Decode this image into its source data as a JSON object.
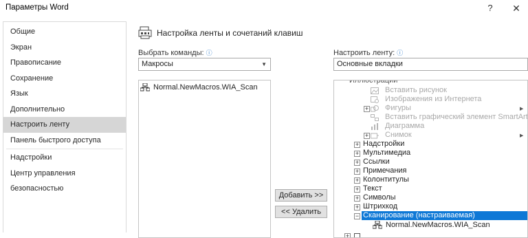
{
  "window": {
    "title": "Параметры Word",
    "help_label": "?",
    "close_label": "✕"
  },
  "nav": {
    "items": [
      {
        "label": "Общие",
        "selected": false
      },
      {
        "label": "Экран",
        "selected": false
      },
      {
        "label": "Правописание",
        "selected": false
      },
      {
        "label": "Сохранение",
        "selected": false
      },
      {
        "label": "Язык",
        "selected": false
      },
      {
        "label": "Дополнительно",
        "selected": false
      },
      {
        "label": "Настроить ленту",
        "selected": true
      },
      {
        "label": "Панель быстрого доступа",
        "selected": false
      },
      {
        "label": "Надстройки",
        "selected": false
      },
      {
        "label": "Центр управления безопасностью",
        "selected": false
      }
    ]
  },
  "main": {
    "header": "Настройка ленты и сочетаний клавиш",
    "choose_commands_label": "Выбрать команды:",
    "choose_commands_value": "Макросы",
    "customize_ribbon_label": "Настроить ленту:",
    "customize_ribbon_value": "Основные вкладки",
    "info_icon": "ⓘ",
    "dropdown_arrow": "▼",
    "left_list": [
      {
        "label": "Normal.NewMacros.WIA_Scan"
      }
    ],
    "add_button": "Добавить >>",
    "remove_button": "<< Удалить",
    "tree": {
      "cut_top": "Иллюстрации",
      "illustrations": [
        {
          "label": "Вставить рисунок",
          "expander": false,
          "arrow": false
        },
        {
          "label": "Изображения из Интернета",
          "expander": false,
          "arrow": false
        },
        {
          "label": "Фигуры",
          "expander": true,
          "arrow": true
        },
        {
          "label": "Вставить графический элемент SmartArt",
          "expander": false,
          "arrow": false
        },
        {
          "label": "Диаграмма",
          "expander": false,
          "arrow": false
        },
        {
          "label": "Снимок",
          "expander": true,
          "arrow": true
        }
      ],
      "groups": [
        "Надстройки",
        "Мультимедиа",
        "Ссылки",
        "Примечания",
        "Колонтитулы",
        "Текст",
        "Символы",
        "Штрихкод"
      ],
      "selected_group": "Сканирование (настраиваемая)",
      "selected_child": "Normal.NewMacros.WIA_Scan",
      "plus_sign": "+",
      "minus_sign": "−",
      "submenu_arrow": "▶"
    }
  },
  "colors": {
    "selection_blue": "#0e78d6",
    "nav_selected_bg": "#d6d6d6",
    "info_blue": "#2b79c8",
    "gray_text": "#a8a8a8"
  }
}
